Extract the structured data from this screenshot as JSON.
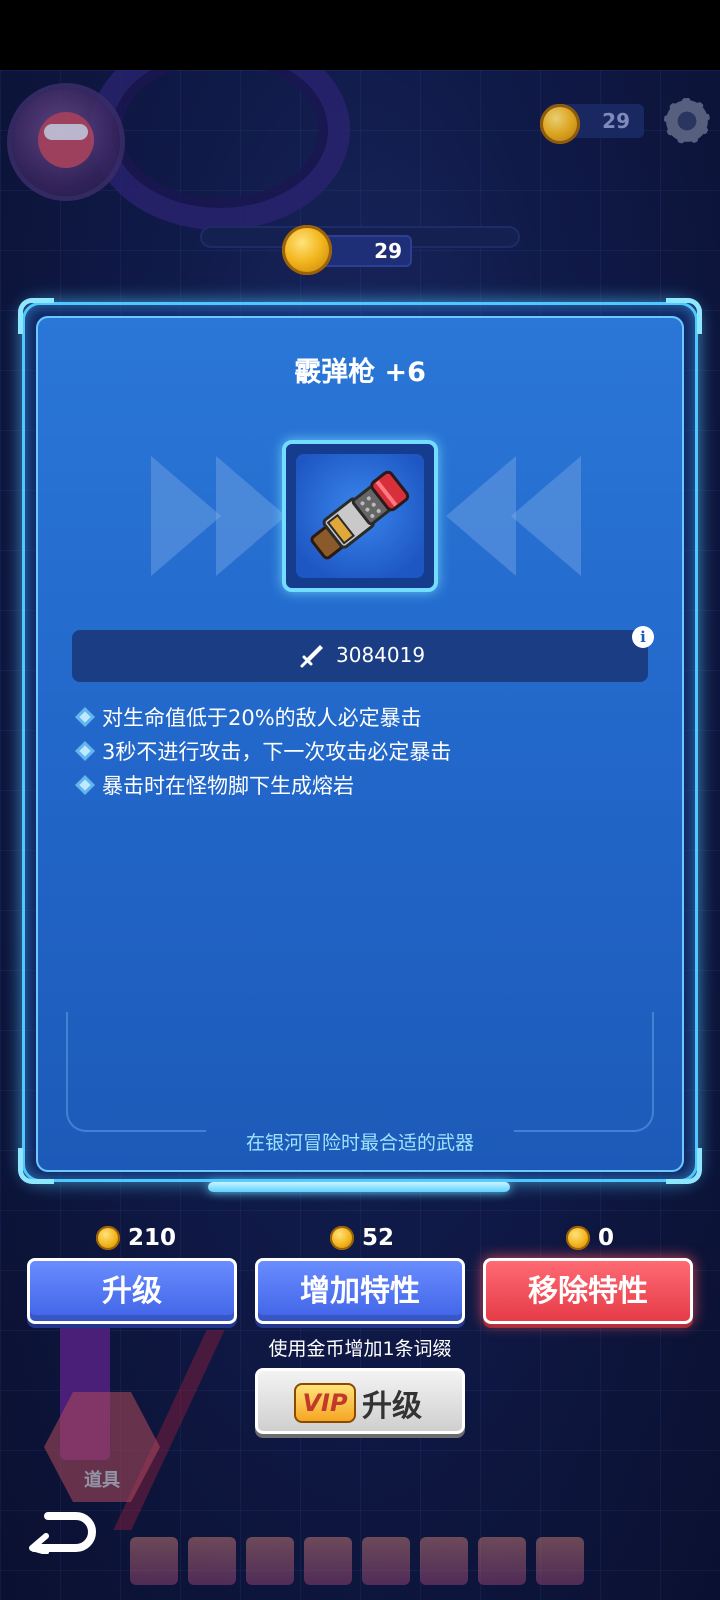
{
  "header": {
    "top_coin_count": "29",
    "center_coin_count": "29"
  },
  "weapon": {
    "name": "霰弹枪 +6",
    "icon": "shotgun-icon",
    "attack_value": "3084019",
    "traits": [
      "对生命值低于20%的敌人必定暴击",
      "3秒不进行攻击，下一次攻击必定暴击",
      "暴击时在怪物脚下生成熔岩"
    ],
    "flavor_text": "在银河冒险时最合适的武器"
  },
  "actions": {
    "upgrade": {
      "cost": "210",
      "label": "升级"
    },
    "add_trait": {
      "cost": "52",
      "label": "增加特性"
    },
    "remove_trait": {
      "cost": "0",
      "label": "移除特性"
    },
    "vip_caption": "使用金币增加1条词缀",
    "vip_badge": "VIP",
    "vip_upgrade_label": "升级"
  },
  "bottom": {
    "item_badge_label": "道具"
  },
  "colors": {
    "panel_blue": "#2166c8",
    "button_blue": "#4f70f0",
    "button_red": "#e53c48",
    "accent_cyan": "#74dcff",
    "coin_gold": "#f2b51c"
  }
}
